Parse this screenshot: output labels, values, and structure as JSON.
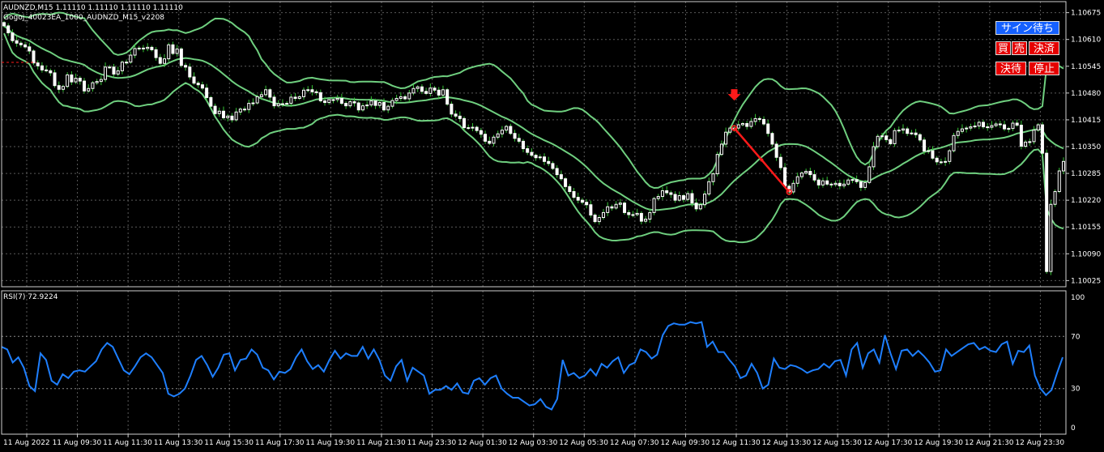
{
  "window": {
    "symbol_line": "AUDNZD,M15  1.11110 1.11110 1.11110 1.11110",
    "ea_line": "Gogoj_40023EA_1000_AUDNZD_M15_v2208"
  },
  "buttons": {
    "sign_wait": "サイン待ち",
    "buy": "買",
    "sell": "売",
    "settle": "決済",
    "settle_wait": "決待",
    "stop": "停止"
  },
  "colors": {
    "background": "#000000",
    "grid": "#5a5a5a",
    "candle": "#ffffff",
    "bollinger": "#6fcf7f",
    "wick": "#36c436",
    "rsi_line": "#1e7fff",
    "signal": "#ff1a1a",
    "button_blue": "#1560ff",
    "button_red": "#e60000"
  },
  "price_axis": {
    "labels": [
      "1.10675",
      "1.10610",
      "1.10545",
      "1.10480",
      "1.10415",
      "1.10350",
      "1.10285",
      "1.10220",
      "1.10155",
      "1.10090",
      "1.10025"
    ]
  },
  "time_axis": {
    "labels": [
      "11 Aug 2022",
      "11 Aug 09:30",
      "11 Aug 11:30",
      "11 Aug 13:30",
      "11 Aug 15:30",
      "11 Aug 17:30",
      "11 Aug 19:30",
      "11 Aug 21:30",
      "11 Aug 23:30",
      "12 Aug 01:30",
      "12 Aug 03:30",
      "12 Aug 05:30",
      "12 Aug 07:30",
      "12 Aug 09:30",
      "12 Aug 11:30",
      "12 Aug 13:30",
      "12 Aug 15:30",
      "12 Aug 17:30",
      "12 Aug 19:30",
      "12 Aug 21:30",
      "12 Aug 23:30"
    ]
  },
  "rsi": {
    "label": "RSI(7) 72.9224",
    "levels": [
      "100",
      "70",
      "30",
      "0"
    ],
    "level_values": [
      100,
      70,
      30,
      0
    ],
    "values": [
      62,
      60,
      50,
      54,
      46,
      32,
      28,
      57,
      52,
      36,
      33,
      41,
      38,
      43,
      44,
      43,
      47,
      51,
      60,
      65,
      62,
      53,
      44,
      41,
      47,
      54,
      57,
      54,
      48,
      42,
      26,
      24,
      26,
      30,
      40,
      52,
      55,
      48,
      39,
      46,
      56,
      57,
      44,
      52,
      53,
      60,
      56,
      46,
      44,
      37,
      43,
      42,
      45,
      54,
      60,
      51,
      45,
      48,
      43,
      52,
      59,
      53,
      57,
      55,
      55,
      62,
      53,
      60,
      52,
      40,
      36,
      47,
      52,
      36,
      46,
      43,
      40,
      26,
      29,
      29,
      32,
      29,
      34,
      27,
      26,
      36,
      38,
      33,
      38,
      40,
      30,
      26,
      23,
      23,
      20,
      17,
      18,
      22,
      16,
      14,
      22,
      52,
      40,
      42,
      38,
      40,
      45,
      40,
      49,
      46,
      51,
      54,
      42,
      48,
      50,
      60,
      58,
      53,
      56,
      71,
      78,
      80,
      79,
      79,
      81,
      80,
      81,
      62,
      66,
      58,
      58,
      52,
      47,
      38,
      40,
      49,
      42,
      30,
      33,
      53,
      46,
      45,
      48,
      47,
      45,
      42,
      44,
      45,
      49,
      46,
      51,
      52,
      40,
      60,
      65,
      46,
      57,
      60,
      50,
      71,
      57,
      45,
      59,
      60,
      55,
      59,
      55,
      50,
      43,
      44,
      60,
      55,
      58,
      61,
      64,
      65,
      60,
      62,
      59,
      58,
      64,
      66,
      49,
      59,
      58,
      63,
      40,
      30,
      25,
      29,
      42,
      54
    ],
    "ylim": [
      0,
      100
    ]
  },
  "price_series": {
    "ylim": [
      1.1001,
      1.1069
    ],
    "close": [
      1.10643,
      1.10626,
      1.10607,
      1.10601,
      1.10597,
      1.10592,
      1.10582,
      1.10553,
      1.10546,
      1.10536,
      1.10534,
      1.10529,
      1.10498,
      1.10489,
      1.10496,
      1.10524,
      1.10507,
      1.10516,
      1.10509,
      1.10485,
      1.10491,
      1.10505,
      1.10508,
      1.10513,
      1.10543,
      1.10543,
      1.10526,
      1.10534,
      1.10555,
      1.10555,
      1.10572,
      1.10588,
      1.10589,
      1.10588,
      1.10591,
      1.10585,
      1.10566,
      1.10552,
      1.10563,
      1.10597,
      1.10576,
      1.10587,
      1.10547,
      1.10543,
      1.10519,
      1.10504,
      1.105,
      1.10492,
      1.10469,
      1.10448,
      1.1043,
      1.10436,
      1.1042,
      1.10424,
      1.10415,
      1.10434,
      1.10441,
      1.1044,
      1.10455,
      1.10456,
      1.10471,
      1.10476,
      1.10488,
      1.1047,
      1.10449,
      1.10454,
      1.10454,
      1.10455,
      1.1047,
      1.10467,
      1.10471,
      1.10487,
      1.10488,
      1.10483,
      1.10481,
      1.10461,
      1.10457,
      1.10464,
      1.10464,
      1.10467,
      1.10455,
      1.10449,
      1.10459,
      1.10456,
      1.10439,
      1.10449,
      1.10451,
      1.10461,
      1.1045,
      1.10457,
      1.10439,
      1.10448,
      1.10462,
      1.10467,
      1.10471,
      1.10466,
      1.1048,
      1.10491,
      1.10495,
      1.10484,
      1.10479,
      1.10492,
      1.10487,
      1.10475,
      1.10488,
      1.10453,
      1.10429,
      1.10424,
      1.10418,
      1.10396,
      1.10395,
      1.10397,
      1.10389,
      1.1038,
      1.10363,
      1.10358,
      1.10373,
      1.10381,
      1.1039,
      1.10399,
      1.10382,
      1.1037,
      1.10363,
      1.10345,
      1.10336,
      1.10329,
      1.10323,
      1.10325,
      1.10314,
      1.10309,
      1.10297,
      1.10282,
      1.10272,
      1.10253,
      1.10241,
      1.10227,
      1.1022,
      1.10215,
      1.10209,
      1.10184,
      1.10168,
      1.10178,
      1.1019,
      1.10204,
      1.10201,
      1.1021,
      1.10213,
      1.1019,
      1.10185,
      1.10185,
      1.10188,
      1.10169,
      1.10174,
      1.1019,
      1.10224,
      1.10229,
      1.10243,
      1.10238,
      1.10234,
      1.1022,
      1.10231,
      1.10222,
      1.10236,
      1.10213,
      1.10199,
      1.10209,
      1.10235,
      1.10265,
      1.10284,
      1.10331,
      1.10356,
      1.10385,
      1.10395,
      1.10395,
      1.10403,
      1.10406,
      1.10399,
      1.10411,
      1.10418,
      1.10416,
      1.10405,
      1.10382,
      1.10356,
      1.10324,
      1.10299,
      1.10254,
      1.1024,
      1.10261,
      1.10277,
      1.10286,
      1.1029,
      1.10282,
      1.10269,
      1.10257,
      1.10267,
      1.10259,
      1.10258,
      1.10261,
      1.10255,
      1.10259,
      1.10269,
      1.1027,
      1.10265,
      1.10251,
      1.10263,
      1.10301,
      1.1035,
      1.10375,
      1.10376,
      1.10367,
      1.10357,
      1.10389,
      1.1039,
      1.10393,
      1.10382,
      1.10383,
      1.10379,
      1.10366,
      1.10339,
      1.1034,
      1.10322,
      1.10313,
      1.10312,
      1.10314,
      1.1034,
      1.10377,
      1.10387,
      1.10393,
      1.10395,
      1.10398,
      1.104,
      1.10409,
      1.10398,
      1.10397,
      1.10401,
      1.10405,
      1.10403,
      1.10393,
      1.10394,
      1.10407,
      1.10402,
      1.10351,
      1.10361,
      1.10362,
      1.1039,
      1.10403,
      1.10334,
      1.10047,
      1.1021,
      1.10241,
      1.10291,
      1.10314
    ]
  },
  "signal": {
    "arrow": "sell-down-arrow"
  }
}
